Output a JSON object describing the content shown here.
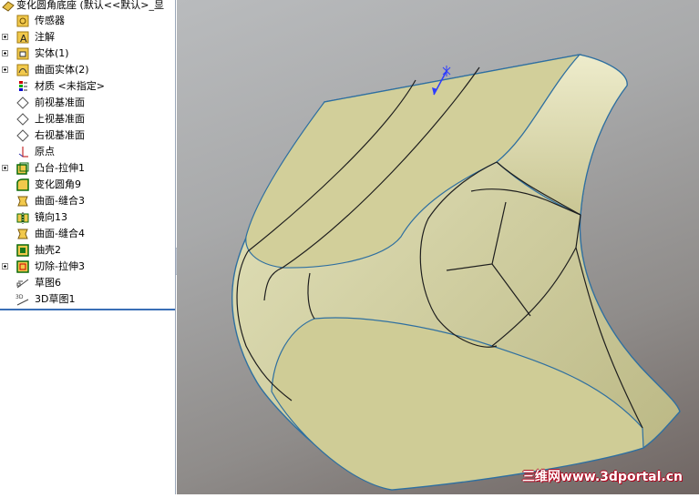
{
  "tree": {
    "root_label": "变化圆角底座    (默认<<默认>_显",
    "items": [
      {
        "label": "传感器",
        "expand": false,
        "icon": "sensor-icon"
      },
      {
        "label": "注解",
        "expand": true,
        "icon": "annotation-icon"
      },
      {
        "label": "实体(1)",
        "expand": true,
        "icon": "solid-body-icon"
      },
      {
        "label": "曲面实体(2)",
        "expand": true,
        "icon": "surface-body-icon"
      },
      {
        "label": "材质 <未指定>",
        "expand": false,
        "icon": "material-icon"
      },
      {
        "label": "前视基准面",
        "expand": false,
        "icon": "plane-icon"
      },
      {
        "label": "上视基准面",
        "expand": false,
        "icon": "plane-icon"
      },
      {
        "label": "右视基准面",
        "expand": false,
        "icon": "plane-icon"
      },
      {
        "label": "原点",
        "expand": false,
        "icon": "origin-icon"
      },
      {
        "label": "凸台-拉伸1",
        "expand": true,
        "icon": "boss-extrude-icon"
      },
      {
        "label": "变化圆角9",
        "expand": false,
        "icon": "variable-fillet-icon"
      },
      {
        "label": "曲面-缝合3",
        "expand": false,
        "icon": "surface-knit-icon"
      },
      {
        "label": "镜向13",
        "expand": false,
        "icon": "mirror-icon"
      },
      {
        "label": "曲面-缝合4",
        "expand": false,
        "icon": "surface-knit-icon"
      },
      {
        "label": "抽壳2",
        "expand": false,
        "icon": "shell-icon"
      },
      {
        "label": "切除-拉伸3",
        "expand": true,
        "icon": "cut-extrude-icon"
      },
      {
        "label": "草图6",
        "expand": false,
        "icon": "sketch-icon"
      },
      {
        "label": "3D草图1",
        "expand": false,
        "icon": "sketch-3d-icon"
      }
    ]
  },
  "watermark": "三维网www.3dportal.cn",
  "colors": {
    "model_face": "#d6d4a4",
    "model_edge_blue": "#2e6fa0",
    "tree_separator": "#3a6fb6"
  }
}
